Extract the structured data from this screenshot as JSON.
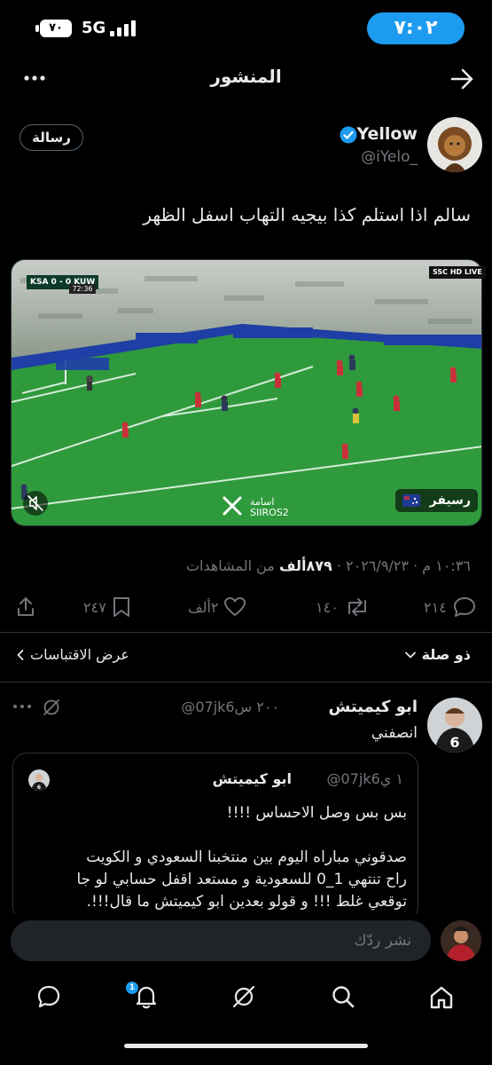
{
  "status_bar": {
    "time": "٧:٠٢",
    "battery": "٧٠",
    "network": "5G"
  },
  "header": {
    "title": "المنشور"
  },
  "post": {
    "author_name": "Yellow",
    "author_handle": "@iYelo_",
    "message_button": "رسالة",
    "text": "سالم اذا استلم كذا بيجيه التهاب اسفل الظهر",
    "media": {
      "scoreboard": "KSA 0 - 0 KUW",
      "match_time": "72:36",
      "broadcaster": "SSC HD LIVE",
      "watermark_name": "اسامة",
      "watermark_handle": "SIIROS2",
      "source_label": "رسيفر"
    },
    "meta": {
      "timestamp": "١٠:٣٦ م · ٢٠٢٦/٩/٢٣ · ",
      "views": "٨٧٩ألف",
      "views_label": " من المشاهدات"
    },
    "actions": {
      "replies": "٢١٤",
      "reposts": "١٤٠",
      "likes": "٢ألف",
      "bookmarks": "٢٤٧"
    }
  },
  "filters": {
    "reply_sort": "ذو صلة",
    "view_quotes": "عرض الاقتباسات"
  },
  "reply": {
    "author_name": "ابو كيميتش",
    "author_handle": "@07jk6",
    "time": "٢٠٠ س",
    "text": "انصفني",
    "quote": {
      "author_name": "ابو كيميتش",
      "author_handle": "@07jk6",
      "time": "١ ي",
      "lines": [
        "بس بس وصل الاحساس !!!!",
        "",
        "صدقوني مباراه اليوم بين منتخبنا السعودي و الكويت",
        "راح تنتهي 1_0  للسعودية و مستعد اقفل حسابي لو جا",
        "توقعي غلط !!! و قولو بعدين ابو كيميتش ما قال!!!."
      ]
    }
  },
  "composer": {
    "placeholder": "نشر ردّك"
  },
  "bottom_nav": {
    "notifications_badge": "1"
  },
  "colors": {
    "accent": "#1d9bf0",
    "background": "#000000",
    "text_primary": "#e7e9ea",
    "text_secondary": "#71767b",
    "separator": "#2f3336",
    "pitch_green": "#2f9a3c"
  }
}
